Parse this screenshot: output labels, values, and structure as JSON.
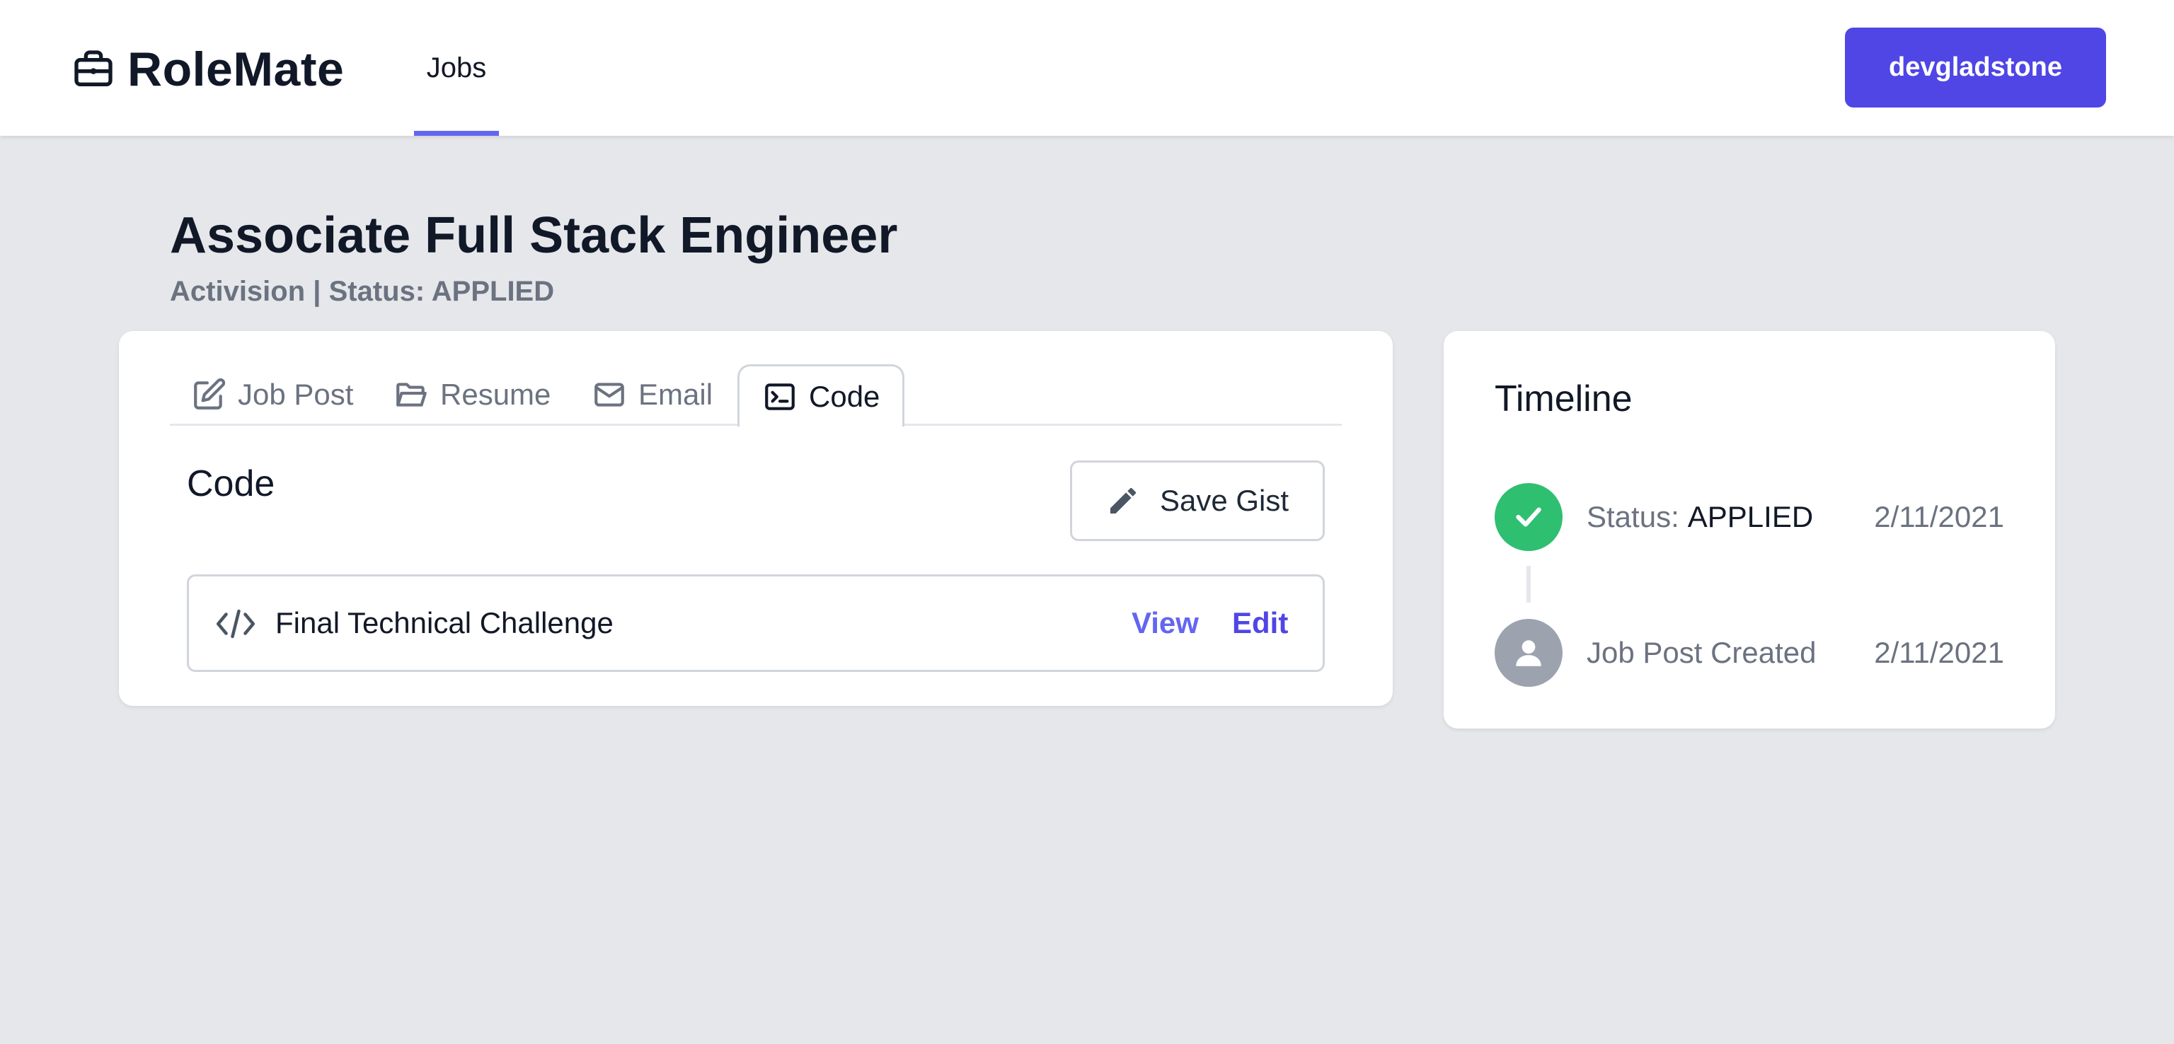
{
  "app": {
    "name": "RoleMate",
    "nav_tab": "Jobs",
    "user_button": "devgladstone",
    "accent_color": "#4f46e5"
  },
  "job": {
    "title": "Associate Full Stack Engineer",
    "subtitle": "Activision | Status: APPLIED"
  },
  "tabs": [
    {
      "label": "Job Post",
      "icon": "pencil-square-icon",
      "active": false
    },
    {
      "label": "Resume",
      "icon": "folder-open-icon",
      "active": false
    },
    {
      "label": "Email",
      "icon": "envelope-icon",
      "active": false
    },
    {
      "label": "Code",
      "icon": "terminal-icon",
      "active": true
    }
  ],
  "code_section": {
    "title": "Code",
    "save_button": "Save Gist",
    "items": [
      {
        "label": "Final Technical Challenge",
        "view": "View",
        "edit": "Edit"
      }
    ]
  },
  "timeline": {
    "title": "Timeline",
    "events": [
      {
        "prefix": "Status:",
        "value": "APPLIED",
        "date": "2/11/2021",
        "icon": "check-icon",
        "color": "#2fbf71"
      },
      {
        "prefix": "Job Post Created",
        "value": "",
        "date": "2/11/2021",
        "icon": "user-icon",
        "color": "#9ca3af"
      }
    ]
  }
}
